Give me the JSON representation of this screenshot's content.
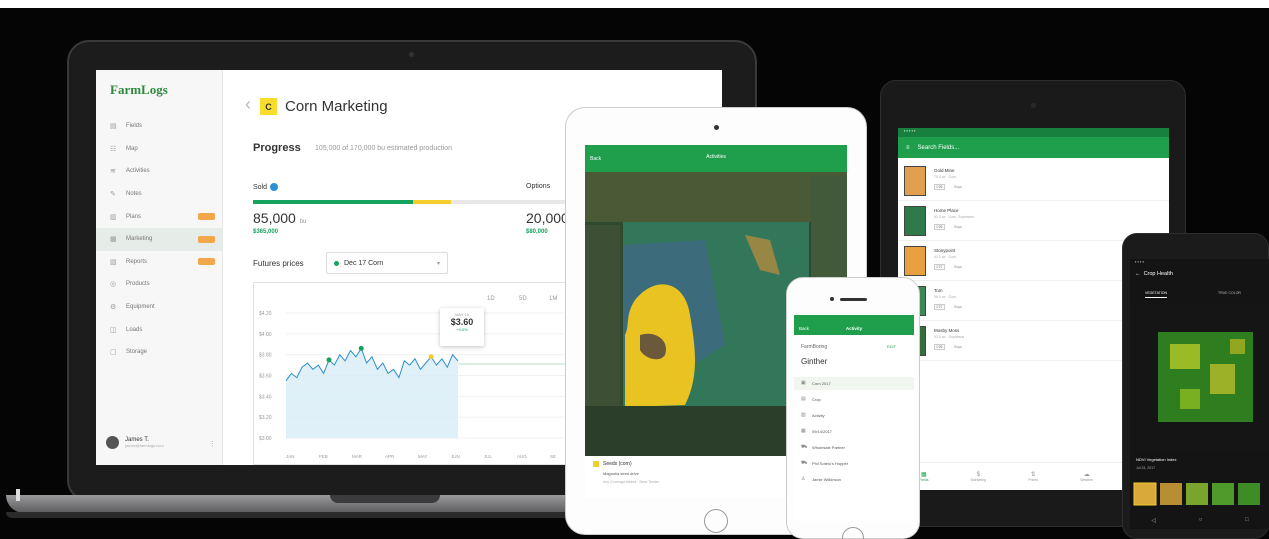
{
  "laptop": {
    "logo": "FarmLogs",
    "nav": [
      {
        "label": "Fields",
        "icon": "fields-icon",
        "glyph": "▤",
        "badge": false,
        "active": false
      },
      {
        "label": "Map",
        "icon": "map-icon",
        "glyph": "☷",
        "badge": false,
        "active": false
      },
      {
        "label": "Activities",
        "icon": "activities-icon",
        "glyph": "≋",
        "badge": false,
        "active": false
      },
      {
        "label": "Notes",
        "icon": "notes-icon",
        "glyph": "✎",
        "badge": false,
        "active": false
      },
      {
        "label": "Plans",
        "icon": "plans-icon",
        "glyph": "▥",
        "badge": true,
        "active": false
      },
      {
        "label": "Marketing",
        "icon": "marketing-icon",
        "glyph": "▦",
        "badge": true,
        "active": true
      },
      {
        "label": "Reports",
        "icon": "reports-icon",
        "glyph": "▧",
        "badge": true,
        "active": false
      },
      {
        "label": "Products",
        "icon": "products-icon",
        "glyph": "◎",
        "badge": false,
        "active": false
      },
      {
        "label": "Equipment",
        "icon": "equipment-icon",
        "glyph": "⚙",
        "badge": false,
        "active": false
      },
      {
        "label": "Loads",
        "icon": "loads-icon",
        "glyph": "◫",
        "badge": false,
        "active": false
      },
      {
        "label": "Storage",
        "icon": "storage-icon",
        "glyph": "▢",
        "badge": false,
        "active": false
      }
    ],
    "user": {
      "name": "James T.",
      "sub": "james@farmlogs.com"
    },
    "crop_badge": "C",
    "page_title": "Corn Marketing",
    "progress": {
      "title": "Progress",
      "subtitle": "105,000 of 170,000 bu estimated production",
      "sold_label": "Sold",
      "sold_value": "85,000",
      "sold_unit": "bu",
      "sold_usd": "$365,000",
      "options_label": "Options",
      "options_value": "20,000",
      "options_usd": "$80,000",
      "sold_fraction": 0.5,
      "options_fraction": 0.118
    },
    "futures": {
      "label": "Futures prices",
      "selected": "Dec 17 Corn",
      "ranges": [
        "1D",
        "5D",
        "1M"
      ]
    },
    "tooltip": {
      "date": "MAY 15",
      "price": "$3.60",
      "change": "+0.6%"
    }
  },
  "chart_data": {
    "type": "line",
    "title": "",
    "xlabel": "",
    "ylabel": "",
    "categories": [
      "JAN",
      "FEB",
      "MAR",
      "APR",
      "MAY",
      "JUN",
      "JUL",
      "AUG",
      "SE"
    ],
    "y_ticks": [
      "$4.20",
      "$4.00",
      "$3.80",
      "$3.60",
      "$3.40",
      "$3.20",
      "$3.00"
    ],
    "ylim": [
      3.0,
      4.2
    ],
    "series": [
      {
        "values": [
          3.55,
          3.62,
          3.58,
          3.68,
          3.72,
          3.66,
          3.7,
          3.62,
          3.75,
          3.7,
          3.8,
          3.74,
          3.84,
          3.78,
          3.86,
          3.72,
          3.78,
          3.66,
          3.72,
          3.62,
          3.66,
          3.58,
          3.74,
          3.7,
          3.76,
          3.66,
          3.72,
          3.78,
          3.7,
          3.76,
          3.68,
          3.8,
          3.74
        ]
      }
    ],
    "markers": [
      {
        "index": 8,
        "value": 3.75,
        "color": "#17a35e"
      },
      {
        "index": 14,
        "value": 3.86,
        "color": "#17a35e"
      },
      {
        "index": 27,
        "value": 3.78,
        "color": "#f4cd2a"
      }
    ],
    "target_line": 3.71,
    "grid": true
  },
  "ipad": {
    "back": "Back",
    "title": "Activities",
    "sheet_title": "Seeds (corn)",
    "sheet_line2": "Magnolia seed drive",
    "sheet_line3": "Any Coverage Added · Seed Tender"
  },
  "tablet": {
    "search_placeholder": "Search Fields...",
    "fields": [
      {
        "name": "Gold Mine",
        "sub": "75.4 ac · Corn",
        "tag": "1'26",
        "crop": "Soys",
        "color": "#e0a050"
      },
      {
        "name": "Home Place",
        "sub": "81.3 ac · Corn, Soybeans",
        "tag": "1'26",
        "crop": "Soys",
        "color": "#2f7a4a"
      },
      {
        "name": "Stonypoint",
        "sub": "42.1 ac · Corn",
        "tag": "1'27",
        "crop": "Soys",
        "color": "#e8a040"
      },
      {
        "name": "Tom",
        "sub": "56.0 ac · Corn",
        "tag": "1'27",
        "crop": "Soys",
        "color": "#3a8a52"
      },
      {
        "name": "Mosby Moss",
        "sub": "93.5 ac · Soybeans",
        "tag": "1'26",
        "crop": "Soys",
        "color": "#356d3f"
      }
    ],
    "tabs": [
      "Fields",
      "Marketing",
      "Prices",
      "Weather",
      "Storage"
    ]
  },
  "iphone": {
    "back": "Back",
    "title": "Activity",
    "farm": "FarmBoring",
    "edit": "EDIT",
    "name": "Ginther",
    "rows": [
      "Corn 2017",
      "Crop",
      "Activity",
      "09/14/2017",
      "Wholesale Partner",
      "Phil Sotelo's Hopper",
      "Jamie Wilkinson"
    ]
  },
  "phone": {
    "title": "Crop Health",
    "tab1": "VEGETATION",
    "tab2": "TRUE COLOR",
    "label": "NDVI Vegetation Index",
    "date": "Jul 24, 2017"
  }
}
